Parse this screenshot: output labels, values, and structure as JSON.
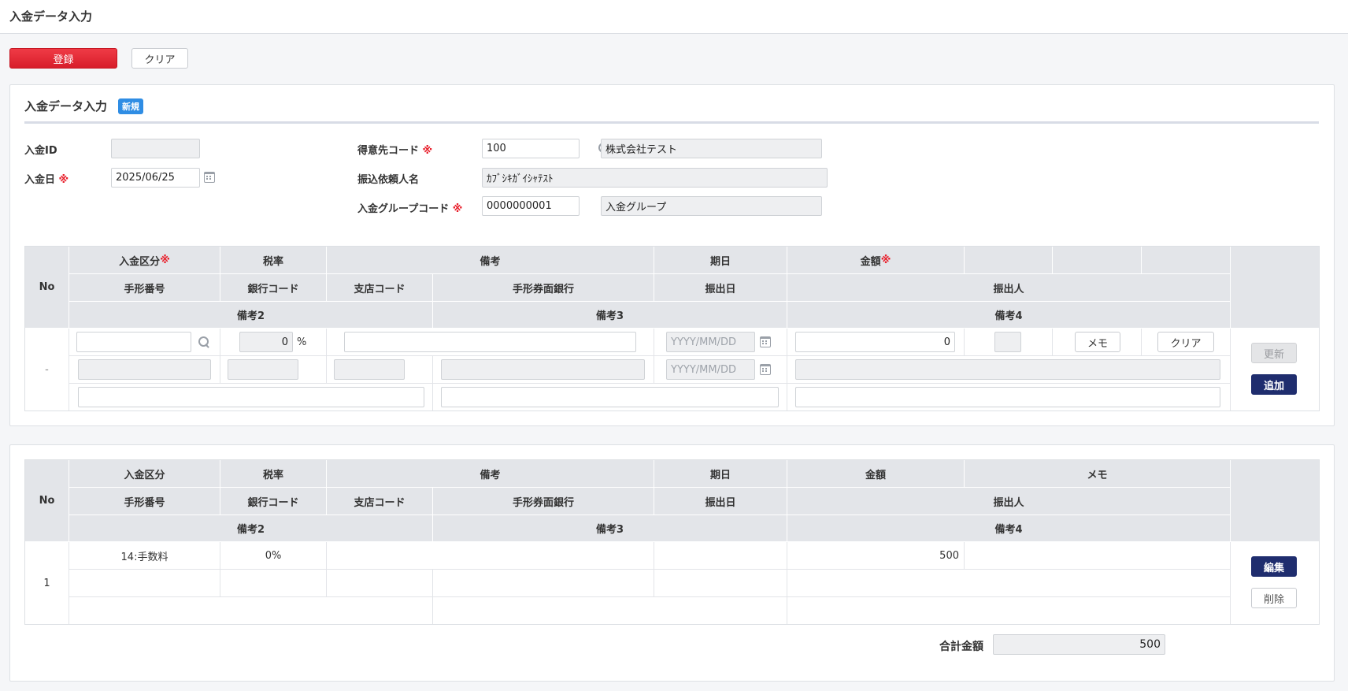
{
  "page": {
    "title": "入金データ入力"
  },
  "toolbar": {
    "register_label": "登録",
    "clear_label": "クリア"
  },
  "form": {
    "section_title": "入金データ入力",
    "badge": "新規",
    "required_mark": "※",
    "nyukin_id": {
      "label": "入金ID",
      "value": ""
    },
    "nyukin_date": {
      "label": "入金日",
      "value": "2025/06/25"
    },
    "customer_code": {
      "label": "得意先コード",
      "value": "100",
      "name": "株式会社テスト"
    },
    "payer_name": {
      "label": "振込依頼人名",
      "value": "ｶﾌﾞｼｷｶﾞｲｼｬﾃｽﾄ"
    },
    "group_code": {
      "label": "入金グループコード",
      "value": "0000000001",
      "name": "入金グループ"
    }
  },
  "headers": {
    "no": "No",
    "kubun": "入金区分",
    "tax": "税率",
    "biko": "備考",
    "kijitsu": "期日",
    "kingaku": "金額",
    "memo": "メモ",
    "tegata_no": "手形番号",
    "bank_code": "銀行コード",
    "branch_code": "支店コード",
    "tegata_bank": "手形券面銀行",
    "furidashi_date": "振出日",
    "furidashi_nin": "振出人",
    "biko2": "備考2",
    "biko3": "備考3",
    "biko4": "備考4"
  },
  "entry_row": {
    "no": "-",
    "tax_value": "0",
    "percent": "%",
    "date_placeholder": "YYYY/MM/DD",
    "amount": "0",
    "memo_button": "メモ",
    "clear_button": "クリア",
    "update_button": "更新",
    "add_button": "追加"
  },
  "list_rows": [
    {
      "no": "1",
      "kubun": "14:手数料",
      "tax": "0%",
      "amount": "500",
      "edit_button": "編集",
      "delete_button": "削除"
    }
  ],
  "total": {
    "label": "合計金額",
    "value": "500"
  },
  "colors": {
    "accent_red": "#e8202c",
    "navy": "#1f2d6e",
    "badge_blue": "#2f8de4"
  }
}
